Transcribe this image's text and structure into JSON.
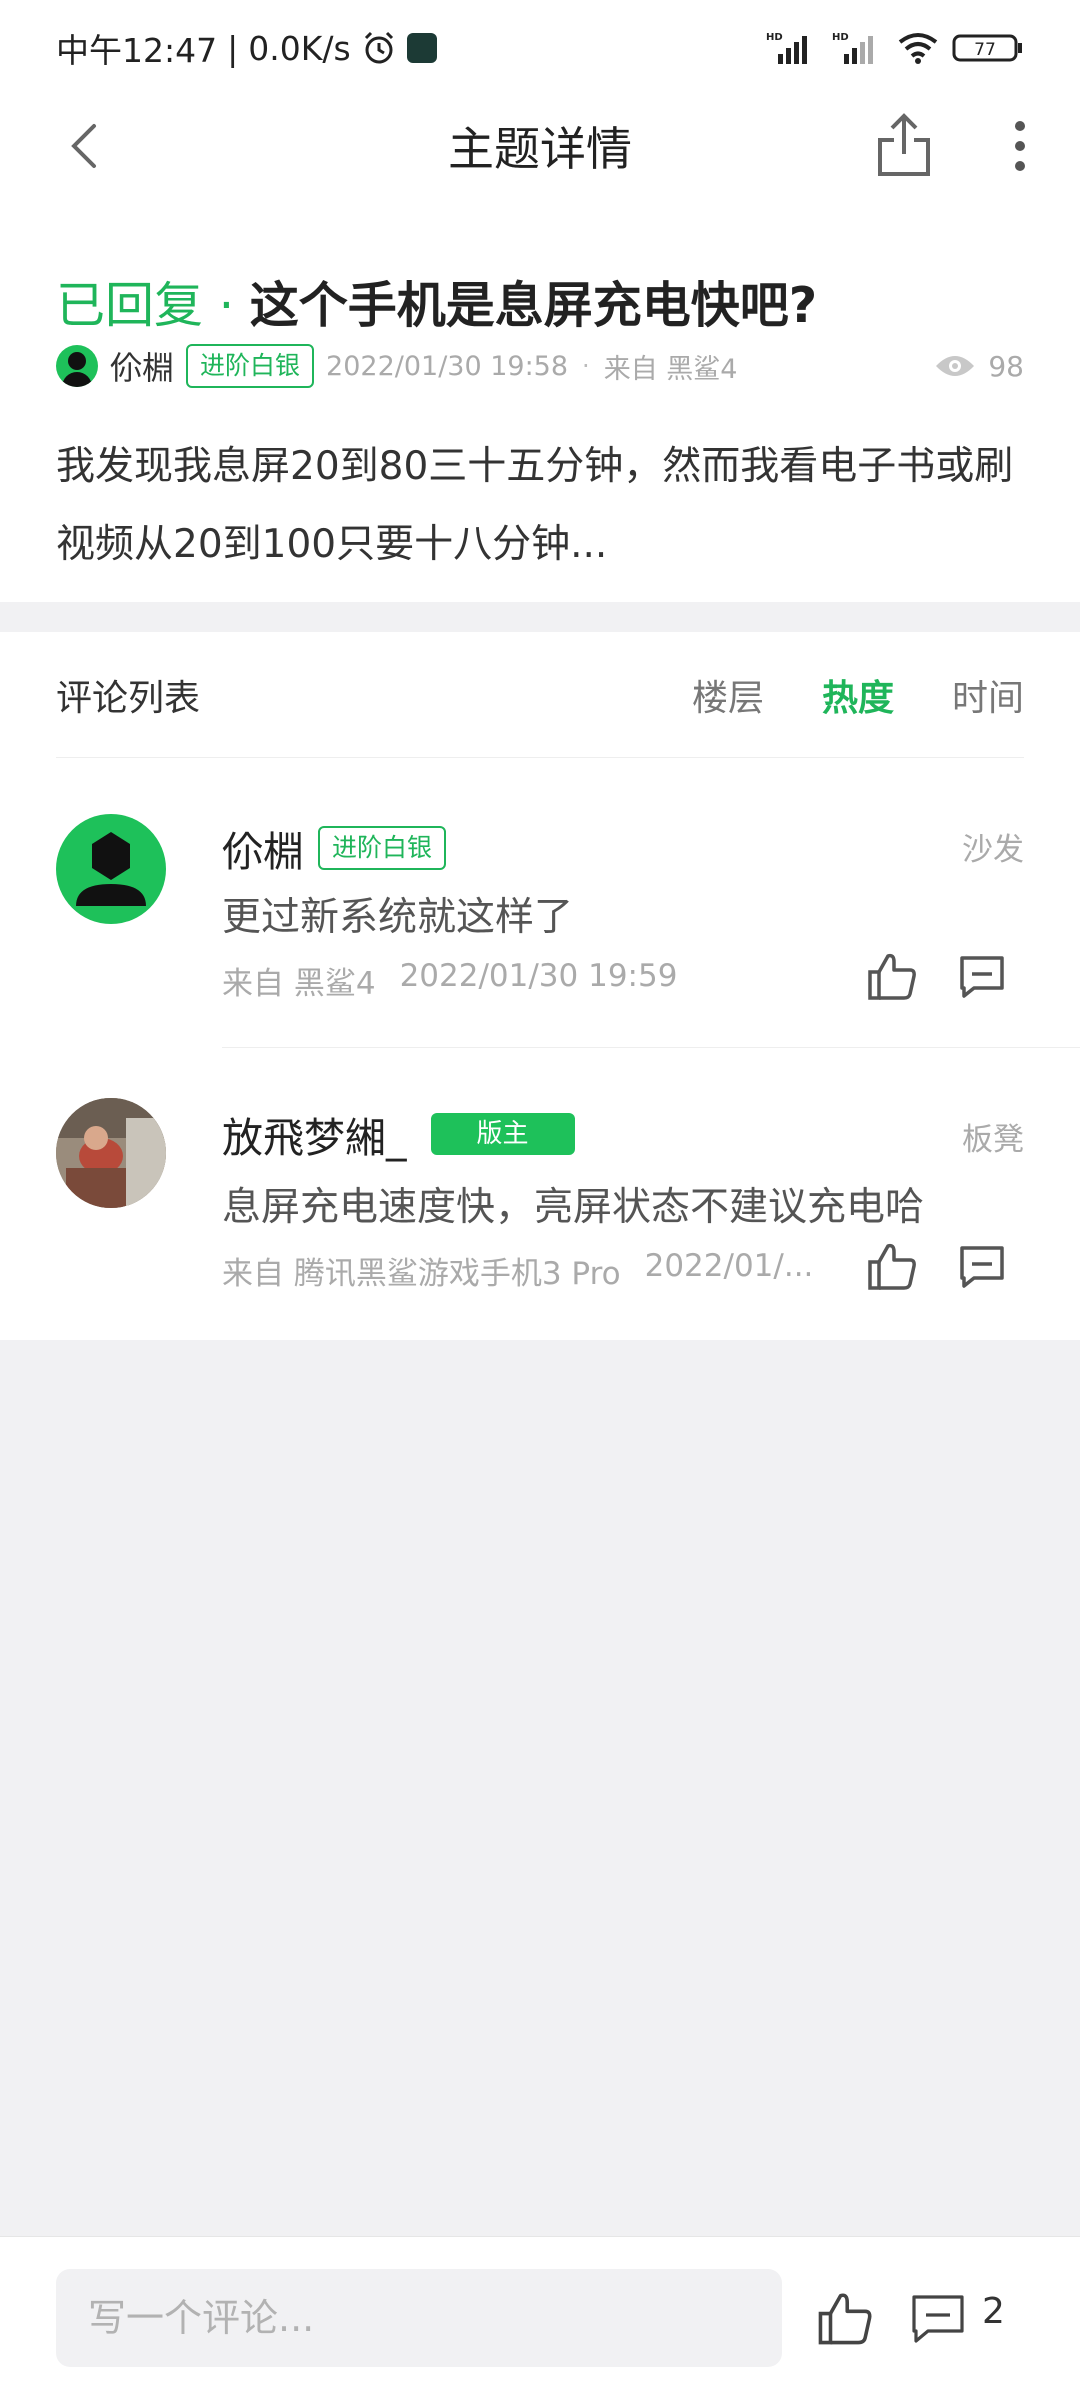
{
  "status_bar": {
    "time": "中午12:47",
    "network_speed": "0.0K/s",
    "battery": "77",
    "signal_label": "HD"
  },
  "header": {
    "title": "主题详情"
  },
  "post": {
    "status": "已回复 · ",
    "title": "这个手机是息屏充电快吧?",
    "author": "伱棩",
    "badge": "进阶白银",
    "time": "2022/01/30 19:58",
    "from": "来自 黑鲨4",
    "views": "98",
    "body": "我发现我息屏20到80三十五分钟，然而我看电子书或刷视频从20到100只要十八分钟..."
  },
  "comments_section": {
    "title": "评论列表",
    "sort_tabs": [
      "楼层",
      "热度",
      "时间"
    ],
    "active_sort": "热度"
  },
  "comments": [
    {
      "name": "伱棩",
      "badge": "进阶白银",
      "floor": "沙发",
      "text": "更过新系统就这样了",
      "from": "来自 黑鲨4",
      "time": "2022/01/30 19:59"
    },
    {
      "name": "放飛梦緗_",
      "badge": "版主",
      "floor": "板凳",
      "text": "息屏充电速度快，亮屏状态不建议充电哈",
      "from": "来自 腾讯黑鲨游戏手机3 Pro",
      "time": "2022/01/..."
    }
  ],
  "bottom_bar": {
    "placeholder": "写一个评论...",
    "comment_count": "2"
  },
  "colors": {
    "accent": "#1fb55a",
    "background": "#f1f1f3"
  }
}
